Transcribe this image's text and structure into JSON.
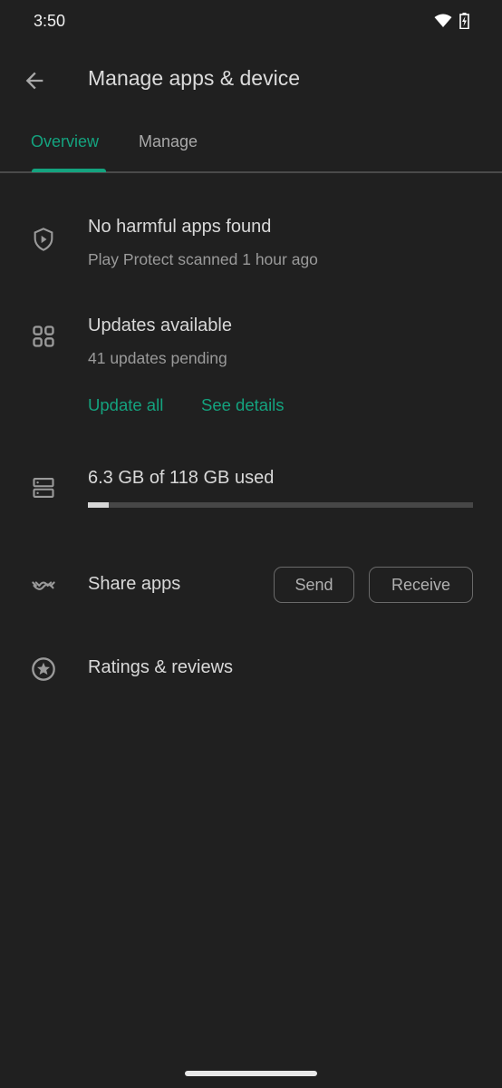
{
  "status_bar": {
    "time": "3:50",
    "icons": [
      "wifi-icon",
      "battery-charging-icon"
    ]
  },
  "app_bar": {
    "back_icon": "arrow-back-icon",
    "title": "Manage apps & device"
  },
  "tabs": [
    {
      "label": "Overview",
      "selected": true
    },
    {
      "label": "Manage",
      "selected": false
    }
  ],
  "sections": {
    "protect": {
      "icon": "shield-play-icon",
      "title": "No harmful apps found",
      "subtitle": "Play Protect scanned 1 hour ago"
    },
    "updates": {
      "icon": "apps-grid-icon",
      "title": "Updates available",
      "subtitle": "41 updates pending",
      "actions": {
        "update_all": "Update all",
        "see_details": "See details"
      }
    },
    "storage": {
      "icon": "storage-icon",
      "label": "6.3 GB of 118 GB used",
      "used_gb": 6.3,
      "total_gb": 118,
      "used_fraction": 0.053
    },
    "share": {
      "icon": "share-apps-icon",
      "label": "Share apps",
      "send": "Send",
      "receive": "Receive"
    },
    "ratings": {
      "icon": "star-circle-icon",
      "label": "Ratings & reviews"
    }
  },
  "colors": {
    "accent": "#14a37f",
    "background": "#202020"
  }
}
